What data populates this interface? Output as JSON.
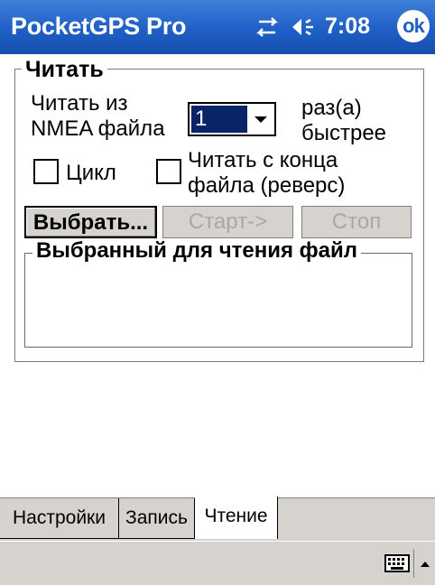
{
  "titlebar": {
    "title": "PocketGPS Pro",
    "time": "7:08",
    "ok_label": "ok",
    "icons": [
      "connectivity-icon",
      "speaker-icon"
    ]
  },
  "read_group": {
    "title": "Читать",
    "read_from_label": "Читать из\nNMEA файла",
    "speed_value": "1",
    "times_faster_label": "раз(а)\nбыстрее",
    "loop_label": "Цикл",
    "reverse_label": "Читать с конца\nфайла (реверс)",
    "loop_checked": false,
    "reverse_checked": false,
    "select_button": "Выбрать...",
    "start_button": "Старт->",
    "stop_button": "Стоп",
    "selected_file_title": "Выбранный для чтения файл"
  },
  "tabs": [
    {
      "label": "Настройки",
      "active": false
    },
    {
      "label": "Запись",
      "active": false
    },
    {
      "label": "Чтение",
      "active": true
    }
  ],
  "bottombar": {
    "icons": [
      "keyboard-icon",
      "sip-arrow-icon"
    ]
  },
  "colors": {
    "titlebar": "#1f5fc6",
    "selection": "#0a246a",
    "chrome": "#d6d3ce",
    "disabled_text": "#a8a8a8"
  }
}
